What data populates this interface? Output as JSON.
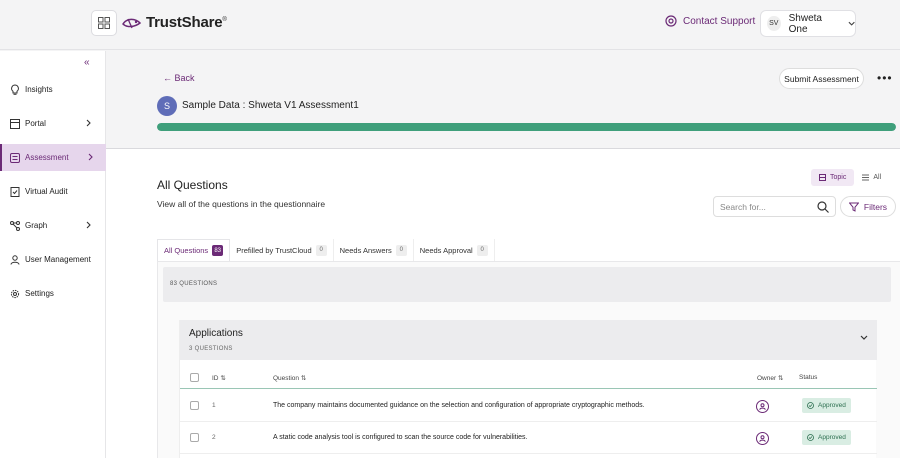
{
  "header": {
    "logo_text": "TrustShare",
    "logo_mark": "®",
    "contact_label": "Contact Support",
    "user_initials": "SV",
    "user_name": "Shweta One"
  },
  "sidebar": {
    "items": [
      {
        "label": "Insights",
        "icon": "lightbulb-icon"
      },
      {
        "label": "Portal",
        "icon": "portal-icon"
      },
      {
        "label": "Assessment",
        "icon": "assessment-icon",
        "active": true
      },
      {
        "label": "Virtual Audit",
        "icon": "audit-icon"
      },
      {
        "label": "Graph",
        "icon": "graph-icon"
      },
      {
        "label": "User Management",
        "icon": "user-icon"
      },
      {
        "label": "Settings",
        "icon": "gear-icon"
      }
    ]
  },
  "assessment": {
    "back_label": "← Back",
    "submit_label": "Submit Assessment",
    "avatar_letter": "S",
    "title": "Sample Data : Shweta V1 Assessment1",
    "progress": 1.0
  },
  "questions": {
    "heading": "All Questions",
    "subheading": "View all of the questions in the questionnaire",
    "view_topic": "Topic",
    "view_all": "All",
    "search_placeholder": "Search for...",
    "filters_label": "Filters",
    "tabs": [
      {
        "label": "All Questions",
        "count": "83"
      },
      {
        "label": "Prefilled by TrustCloud",
        "count": "0"
      },
      {
        "label": "Needs Answers",
        "count": "0"
      },
      {
        "label": "Needs Approval",
        "count": "0"
      }
    ],
    "total_label": "83 QUESTIONS"
  },
  "section": {
    "title": "Applications",
    "subtitle": "3 QUESTIONS",
    "columns": {
      "id": "ID",
      "question": "Question",
      "owner": "Owner",
      "status": "Status"
    },
    "rows": [
      {
        "id": "1",
        "question": "The company maintains documented guidance on the selection and configuration of appropriate cryptographic methods.",
        "status": "Approved"
      },
      {
        "id": "2",
        "question": "A static code analysis tool is configured to scan the source code for vulnerabilities.",
        "status": "Approved"
      }
    ]
  },
  "colors": {
    "brand": "#6b2a76",
    "progress": "#3f9f7b",
    "approved_bg": "#d9ede3"
  }
}
